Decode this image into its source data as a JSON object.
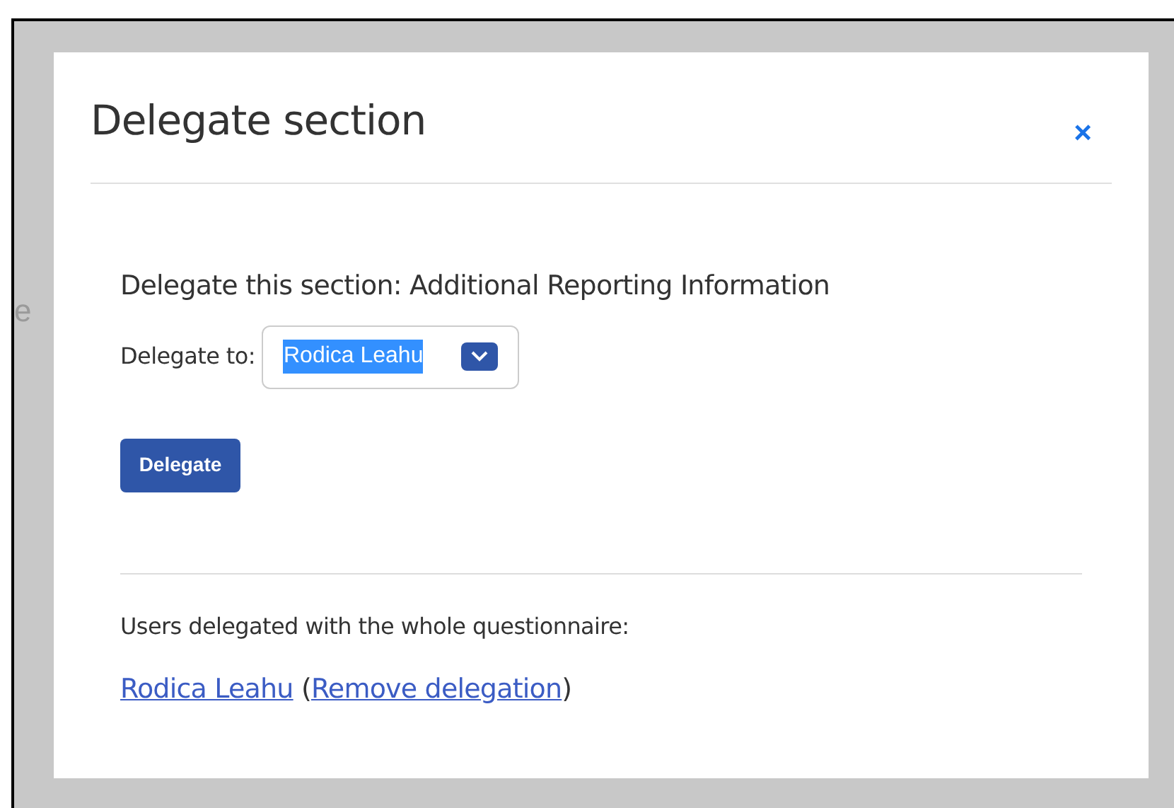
{
  "background": {
    "text_fragment": "e"
  },
  "dialog": {
    "title": "Delegate section",
    "close_label": "×",
    "section_line": "Delegate this section: Additional Reporting Information",
    "delegate_to": {
      "label": "Delegate to:",
      "value": "Rodica Leahu",
      "text_highlighted": true
    },
    "submit_button": "Delegate",
    "users_heading": "Users delegated with the whole questionnaire:",
    "delegations": [
      {
        "user": "Rodica Leahu",
        "open_paren": "(",
        "remove_link": "Remove delegation",
        "close_paren": ")"
      }
    ]
  }
}
